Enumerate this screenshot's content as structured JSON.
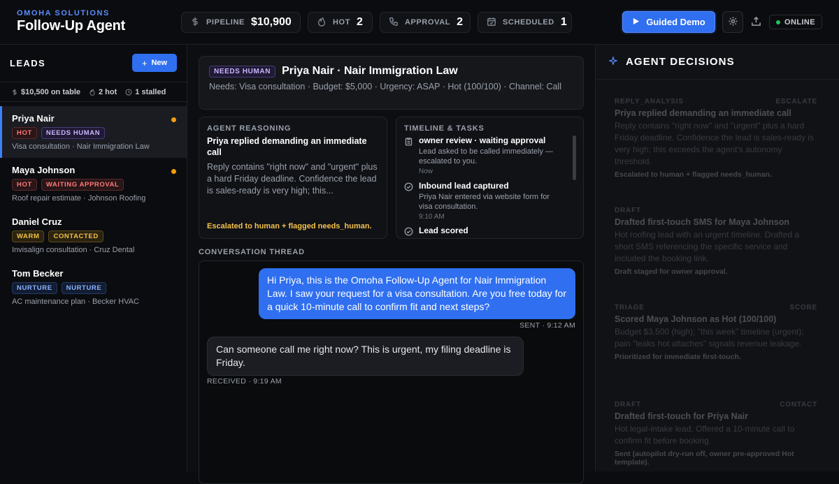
{
  "app": {
    "org": "OMOHA SOLUTIONS",
    "title": "Follow-Up Agent"
  },
  "stats": [
    {
      "label": "PIPELINE",
      "value": "$10,900",
      "icon": "dollar-icon"
    },
    {
      "label": "HOT",
      "value": "2",
      "icon": "flame-icon"
    },
    {
      "label": "APPROVAL",
      "value": "2",
      "icon": "phone-icon"
    },
    {
      "label": "SCHEDULED",
      "value": "1",
      "icon": "calendar-icon"
    }
  ],
  "header": {
    "demo_label": "Guided Demo",
    "status": "ONLINE"
  },
  "leads": {
    "title": "LEADS",
    "new_label": "New",
    "summary": {
      "on_table": "$10,500 on table",
      "hot": "2 hot",
      "stalled": "1 stalled"
    },
    "items": [
      {
        "name": "Priya Nair",
        "tags": [
          "HOT",
          "NEEDS HUMAN"
        ],
        "sub": "Visa consultation · Nair Immigration Law"
      },
      {
        "name": "Maya Johnson",
        "tags": [
          "HOT",
          "WAITING APPROVAL"
        ],
        "sub": "Roof repair estimate · Johnson Roofing"
      },
      {
        "name": "Daniel Cruz",
        "tags": [
          "WARM",
          "CONTACTED"
        ],
        "sub": "Invisalign consultation · Cruz Dental"
      },
      {
        "name": "Tom Becker",
        "tags": [
          "NURTURE",
          "NURTURE"
        ],
        "sub": "AC maintenance plan · Becker HVAC"
      }
    ]
  },
  "detail": {
    "badge": "NEEDS HUMAN",
    "title": "Priya Nair · Nair Immigration Law",
    "meta": "Needs: Visa consultation · Budget: $5,000 · Urgency: ASAP · Hot (100/100) · Channel: Call",
    "reasoning": {
      "heading": "AGENT REASONING",
      "title": "Priya replied demanding an immediate call",
      "body": "Reply contains \"right now\" and \"urgent\" plus a hard Friday deadline. Confidence the lead is sales-ready is very high; this...",
      "footer": "Escalated to human + flagged needs_human."
    },
    "timeline": {
      "heading": "TIMELINE & TASKS",
      "items": [
        {
          "title": "owner review · waiting approval",
          "desc": "Lead asked to be called immediately — escalated to you.",
          "time": "Now"
        },
        {
          "title": "Inbound lead captured",
          "desc": "Priya Nair entered via website form for visa consultation.",
          "time": "9:10 AM"
        },
        {
          "title": "Lead scored",
          "desc": "",
          "time": ""
        }
      ]
    },
    "thread": {
      "heading": "CONVERSATION THREAD",
      "out": {
        "text": "Hi Priya, this is the Omoha Follow-Up Agent for Nair Immigration Law. I saw your request for a visa consultation. Are you free today for a quick 10-minute call to confirm fit and next steps?",
        "meta": "SENT · 9:12 AM"
      },
      "in": {
        "text": "Can someone call me right now? This is urgent, my filing deadline is Friday.",
        "meta": "RECEIVED · 9:19 AM"
      }
    }
  },
  "decisions": {
    "title": "AGENT DECISIONS",
    "items": [
      {
        "kind": "REPLY_ANALYSIS",
        "tag": "ESCALATE",
        "title": "Priya replied demanding an immediate call",
        "desc": "Reply contains \"right now\" and \"urgent\" plus a hard Friday deadline. Confidence the lead is sales-ready is very high; this exceeds the agent's autonomy threshold.",
        "foot": "Escalated to human + flagged needs_human."
      },
      {
        "kind": "DRAFT",
        "tag": "",
        "title": "Drafted first-touch SMS for Maya Johnson",
        "desc": "Hot roofing lead with an urgent timeline. Drafted a short SMS referencing the specific service and included the booking link.",
        "foot": "Draft staged for owner approval."
      },
      {
        "kind": "TRIAGE",
        "tag": "SCORE",
        "title": "Scored Maya Johnson as Hot (100/100)",
        "desc": "Budget $3,500 (high); \"this week\" timeline (urgent); pain \"leaks hot attaches\" signals revenue leakage.",
        "foot": "Prioritized for immediate first-touch."
      },
      {
        "kind": "DRAFT",
        "tag": "CONTACT",
        "title": "Drafted first-touch for Priya Nair",
        "desc": "Hot legal-intake lead. Offered a 10-minute call to confirm fit before booking.",
        "foot": "Sent (autopilot dry-run off, owner pre-approved Hot template)."
      }
    ]
  },
  "colors": {
    "accent": "#2f6ff0",
    "online": "#22c55e",
    "warning": "#f5c14b",
    "unread": "#f59e0b"
  }
}
